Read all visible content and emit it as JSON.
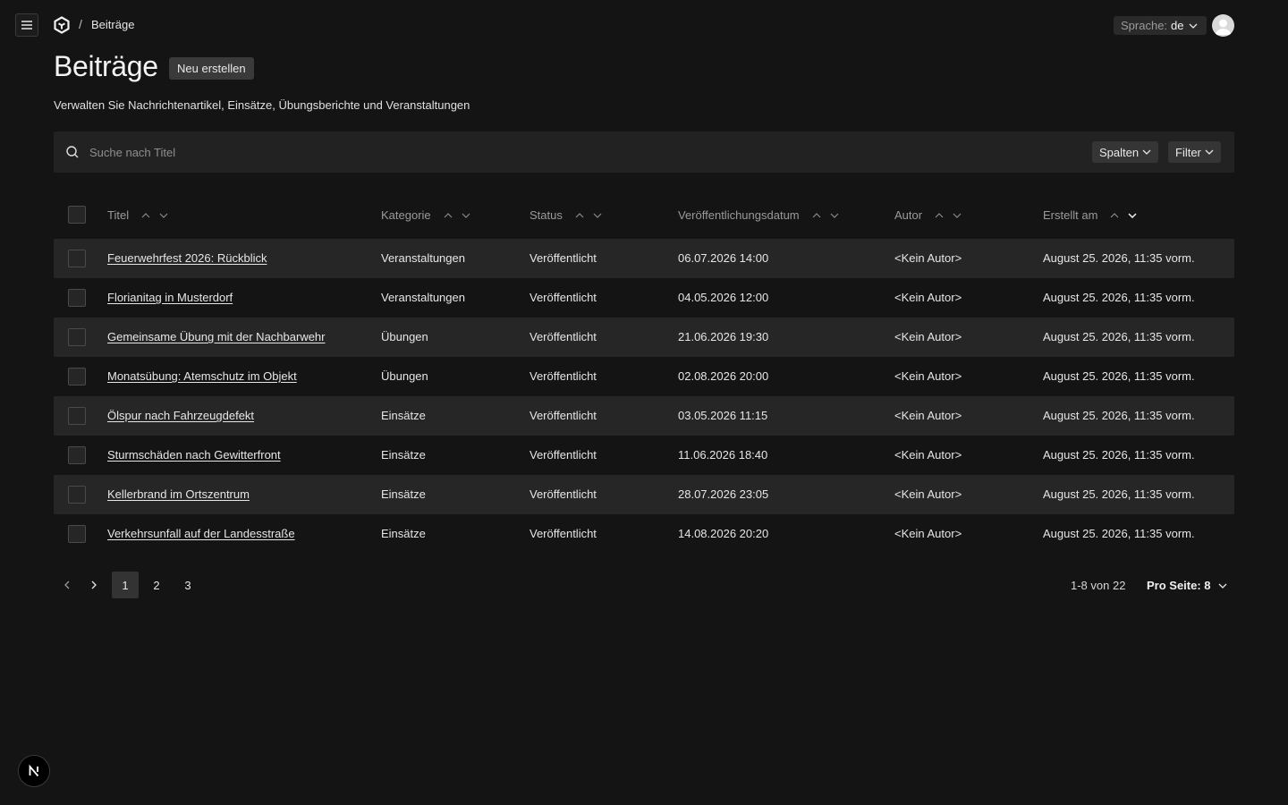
{
  "header": {
    "breadcrumb_separator": "/",
    "breadcrumb_current": "Beiträge",
    "language_label": "Sprache:",
    "language_value": "de"
  },
  "page": {
    "title": "Beiträge",
    "new_button_label": "Neu erstellen",
    "description": "Verwalten Sie Nachrichtenartikel, Einsätze, Übungsberichte und Veranstaltungen"
  },
  "search": {
    "placeholder": "Suche nach Titel",
    "value": "",
    "columns_button": "Spalten",
    "filter_button": "Filter"
  },
  "table": {
    "columns": [
      "Titel",
      "Kategorie",
      "Status",
      "Veröffentlichungsdatum",
      "Autor",
      "Erstellt am"
    ],
    "rows": [
      {
        "title": "Feuerwehrfest 2026: Rückblick",
        "category": "Veranstaltungen",
        "status": "Veröffentlicht",
        "published": "06.07.2026 14:00",
        "author": "<Kein Autor>",
        "created": "August 25. 2026, 11:35 vorm."
      },
      {
        "title": "Florianitag in Musterdorf",
        "category": "Veranstaltungen",
        "status": "Veröffentlicht",
        "published": "04.05.2026 12:00",
        "author": "<Kein Autor>",
        "created": "August 25. 2026, 11:35 vorm."
      },
      {
        "title": "Gemeinsame Übung mit der Nachbarwehr",
        "category": "Übungen",
        "status": "Veröffentlicht",
        "published": "21.06.2026 19:30",
        "author": "<Kein Autor>",
        "created": "August 25. 2026, 11:35 vorm."
      },
      {
        "title": "Monatsübung: Atemschutz im Objekt",
        "category": "Übungen",
        "status": "Veröffentlicht",
        "published": "02.08.2026 20:00",
        "author": "<Kein Autor>",
        "created": "August 25. 2026, 11:35 vorm."
      },
      {
        "title": "Ölspur nach Fahrzeugdefekt",
        "category": "Einsätze",
        "status": "Veröffentlicht",
        "published": "03.05.2026 11:15",
        "author": "<Kein Autor>",
        "created": "August 25. 2026, 11:35 vorm."
      },
      {
        "title": "Sturmschäden nach Gewitterfront",
        "category": "Einsätze",
        "status": "Veröffentlicht",
        "published": "11.06.2026 18:40",
        "author": "<Kein Autor>",
        "created": "August 25. 2026, 11:35 vorm."
      },
      {
        "title": "Kellerbrand im Ortszentrum",
        "category": "Einsätze",
        "status": "Veröffentlicht",
        "published": "28.07.2026 23:05",
        "author": "<Kein Autor>",
        "created": "August 25. 2026, 11:35 vorm."
      },
      {
        "title": "Verkehrsunfall auf der Landesstraße",
        "category": "Einsätze",
        "status": "Veröffentlicht",
        "published": "14.08.2026 20:20",
        "author": "<Kein Autor>",
        "created": "August 25. 2026, 11:35 vorm."
      }
    ]
  },
  "pagination": {
    "pages": [
      "1",
      "2",
      "3"
    ],
    "current_page": "1",
    "range_text": "1-8 von 22",
    "per_page_text": "Pro Seite: 8"
  },
  "next_badge_letter": "N",
  "colors": {
    "background": "#141414",
    "row_shade": "#262626",
    "search_bg": "#222222",
    "button_bg": "#353535"
  }
}
